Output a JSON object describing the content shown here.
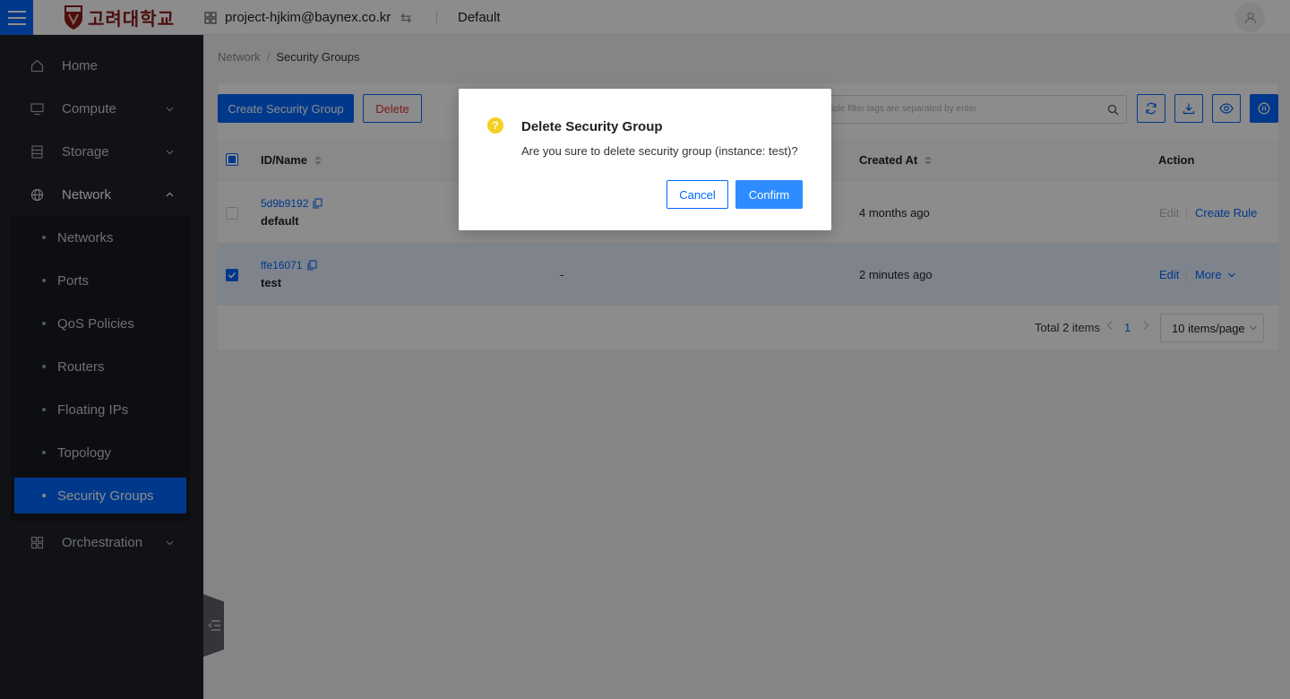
{
  "header": {
    "logo_text": "고려대학교",
    "project": "project-hjkim@baynex.co.kr",
    "domain": "Default"
  },
  "sidebar": {
    "items": [
      {
        "label": "Home",
        "icon": "home-icon"
      },
      {
        "label": "Compute",
        "icon": "monitor-icon"
      },
      {
        "label": "Storage",
        "icon": "storage-icon"
      },
      {
        "label": "Network",
        "icon": "globe-icon"
      },
      {
        "label": "Orchestration",
        "icon": "grid-icon"
      }
    ],
    "network_sub": [
      "Networks",
      "Ports",
      "QoS Policies",
      "Routers",
      "Floating IPs",
      "Topology",
      "Security Groups"
    ]
  },
  "breadcrumb": {
    "parent": "Network",
    "current": "Security Groups"
  },
  "toolbar": {
    "create_label": "Create Security Group",
    "delete_label": "Delete",
    "search_placeholder": "Multiple filter tags are separated by enter"
  },
  "table": {
    "columns": [
      "ID/Name",
      "Created At",
      "Action"
    ],
    "rows": [
      {
        "id": "5d9b9192",
        "name": "default",
        "description": "",
        "created": "4 months ago",
        "actions": [
          "Edit",
          "Create Rule"
        ],
        "checked": false
      },
      {
        "id": "ffe16071",
        "name": "test",
        "description": "-",
        "created": "2 minutes ago",
        "actions": [
          "Edit",
          "More"
        ],
        "checked": true
      }
    ]
  },
  "pagination": {
    "total": "Total 2 items",
    "page": "1",
    "page_size": "10 items/page"
  },
  "modal": {
    "title": "Delete Security Group",
    "content": "Are you sure to delete security group (instance: test)?",
    "cancel_label": "Cancel",
    "confirm_label": "Confirm"
  },
  "colors": {
    "primary": "#0068ff",
    "sidebar_bg": "#1e2129",
    "danger": "#e0332e",
    "warning_icon": "#f5d020"
  }
}
